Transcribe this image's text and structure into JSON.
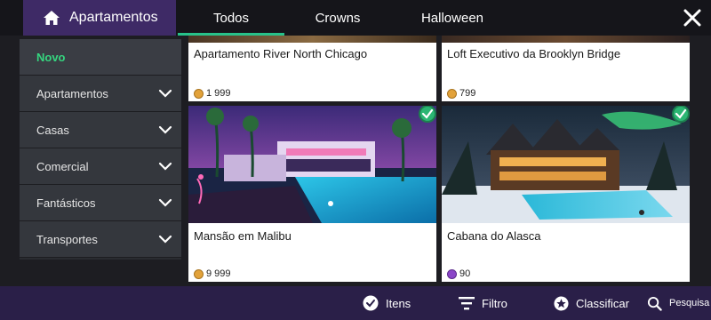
{
  "header": {
    "title": "Apartamentos",
    "tabs": [
      {
        "label": "Todos",
        "active": true
      },
      {
        "label": "Crowns",
        "active": false
      },
      {
        "label": "Halloween",
        "active": false
      }
    ]
  },
  "sidebar": {
    "items": [
      {
        "label": "Novo",
        "active": true,
        "expandable": false
      },
      {
        "label": "Apartamentos",
        "active": false,
        "expandable": true
      },
      {
        "label": "Casas",
        "active": false,
        "expandable": true
      },
      {
        "label": "Comercial",
        "active": false,
        "expandable": true
      },
      {
        "label": "Fantásticos",
        "active": false,
        "expandable": true
      },
      {
        "label": "Transportes",
        "active": false,
        "expandable": true
      }
    ]
  },
  "items": [
    {
      "name": "Apartamento River North Chicago",
      "price": "1 999",
      "currency": "coins",
      "owned": false
    },
    {
      "name": "Loft Executivo da Brooklyn Bridge",
      "price": "799",
      "currency": "coins",
      "owned": false
    },
    {
      "name": "Mansão em Malibu",
      "price": "9 999",
      "currency": "coins",
      "owned": true
    },
    {
      "name": "Cabana do Alasca",
      "price": "90",
      "currency": "crowns",
      "owned": true
    }
  ],
  "footer": {
    "items_label": "Itens",
    "filter_label": "Filtro",
    "sort_label": "Classificar",
    "search_label": "Pesquisa"
  },
  "colors": {
    "accent_green": "#27c28a",
    "header_purple": "#3e2a66",
    "footer_purple": "#2a1f48",
    "coin_gold": "#e2a23a",
    "crown_purple": "#8a45c8"
  }
}
